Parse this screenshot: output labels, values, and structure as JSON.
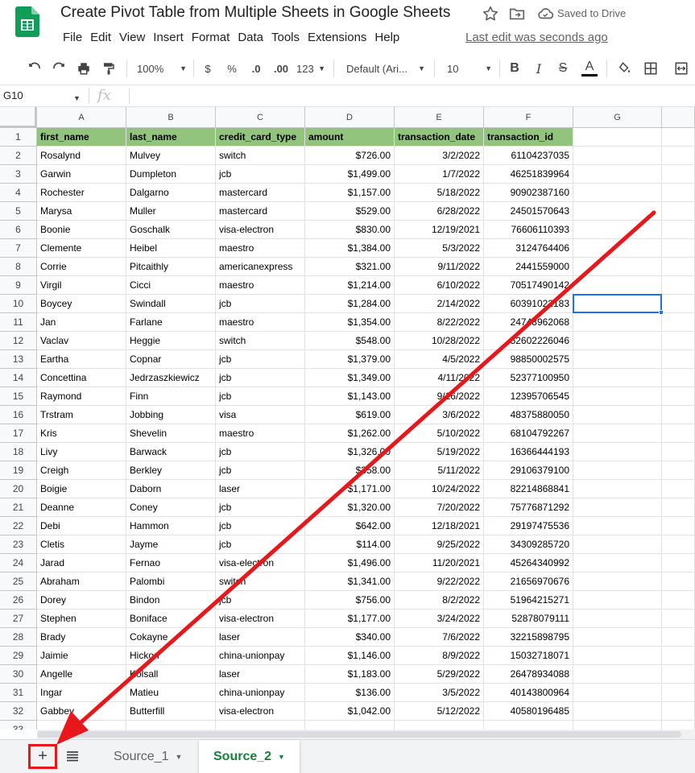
{
  "doc": {
    "title": "Create Pivot Table from Multiple Sheets in Google Sheets",
    "saved_status": "Saved to Drive",
    "last_edit": "Last edit was seconds ago"
  },
  "menu": [
    "File",
    "Edit",
    "View",
    "Insert",
    "Format",
    "Data",
    "Tools",
    "Extensions",
    "Help"
  ],
  "toolbar": {
    "zoom": "100%",
    "currency": "$",
    "percent": "%",
    "decrease_decimal": ".0",
    "increase_decimal": ".00",
    "more_formats": "123",
    "font": "Default (Ari...",
    "font_size": "10",
    "bold": "B",
    "italic": "I",
    "strike": "S",
    "text_color": "A"
  },
  "formula_bar": {
    "name_box": "G10",
    "fx": "fx",
    "value": ""
  },
  "columns": [
    "A",
    "B",
    "C",
    "D",
    "E",
    "F",
    "G"
  ],
  "header_row": [
    "first_name",
    "last_name",
    "credit_card_type",
    "amount",
    "transaction_date",
    "transaction_id"
  ],
  "rows": [
    [
      "Rosalynd",
      "Mulvey",
      "switch",
      "$726.00",
      "3/2/2022",
      "61104237035"
    ],
    [
      "Garwin",
      "Dumpleton",
      "jcb",
      "$1,499.00",
      "1/7/2022",
      "46251839964"
    ],
    [
      "Rochester",
      "Dalgarno",
      "mastercard",
      "$1,157.00",
      "5/18/2022",
      "90902387160"
    ],
    [
      "Marysa",
      "Muller",
      "mastercard",
      "$529.00",
      "6/28/2022",
      "24501570643"
    ],
    [
      "Boonie",
      "Goschalk",
      "visa-electron",
      "$830.00",
      "12/19/2021",
      "76606110393"
    ],
    [
      "Clemente",
      "Heibel",
      "maestro",
      "$1,384.00",
      "5/3/2022",
      "3124764406"
    ],
    [
      "Corrie",
      "Pitcaithly",
      "americanexpress",
      "$321.00",
      "9/11/2022",
      "2441559000"
    ],
    [
      "Virgil",
      "Cicci",
      "maestro",
      "$1,214.00",
      "6/10/2022",
      "70517490142"
    ],
    [
      "Boycey",
      "Swindall",
      "jcb",
      "$1,284.00",
      "2/14/2022",
      "60391022183"
    ],
    [
      "Jan",
      "Farlane",
      "maestro",
      "$1,354.00",
      "8/22/2022",
      "24748962068"
    ],
    [
      "Vaclav",
      "Heggie",
      "switch",
      "$548.00",
      "10/28/2022",
      "52602226046"
    ],
    [
      "Eartha",
      "Copnar",
      "jcb",
      "$1,379.00",
      "4/5/2022",
      "98850002575"
    ],
    [
      "Concettina",
      "Jedrzaszkiewicz",
      "jcb",
      "$1,349.00",
      "4/11/2022",
      "52377100950"
    ],
    [
      "Raymond",
      "Finn",
      "jcb",
      "$1,143.00",
      "9/16/2022",
      "12395706545"
    ],
    [
      "Trstram",
      "Jobbing",
      "visa",
      "$619.00",
      "3/6/2022",
      "48375880050"
    ],
    [
      "Kris",
      "Shevelin",
      "maestro",
      "$1,262.00",
      "5/10/2022",
      "68104792267"
    ],
    [
      "Livy",
      "Barwack",
      "jcb",
      "$1,326.00",
      "5/19/2022",
      "16366444193"
    ],
    [
      "Creigh",
      "Berkley",
      "jcb",
      "$358.00",
      "5/11/2022",
      "29106379100"
    ],
    [
      "Boigie",
      "Daborn",
      "laser",
      "$1,171.00",
      "10/24/2022",
      "82214868841"
    ],
    [
      "Deanne",
      "Coney",
      "jcb",
      "$1,320.00",
      "7/20/2022",
      "75776871292"
    ],
    [
      "Debi",
      "Hammon",
      "jcb",
      "$642.00",
      "12/18/2021",
      "29197475536"
    ],
    [
      "Cletis",
      "Jayme",
      "jcb",
      "$114.00",
      "9/25/2022",
      "34309285720"
    ],
    [
      "Jarad",
      "Fernao",
      "visa-electron",
      "$1,496.00",
      "11/20/2021",
      "45264340992"
    ],
    [
      "Abraham",
      "Palombi",
      "switch",
      "$1,341.00",
      "9/22/2022",
      "21656970676"
    ],
    [
      "Dorey",
      "Bindon",
      "jcb",
      "$756.00",
      "8/2/2022",
      "51964215271"
    ],
    [
      "Stephen",
      "Boniface",
      "visa-electron",
      "$1,177.00",
      "3/24/2022",
      "52878079111"
    ],
    [
      "Brady",
      "Cokayne",
      "laser",
      "$340.00",
      "7/6/2022",
      "32215898795"
    ],
    [
      "Jaimie",
      "Hickon",
      "china-unionpay",
      "$1,146.00",
      "8/9/2022",
      "15032718071"
    ],
    [
      "Angelle",
      "Kolsall",
      "laser",
      "$1,183.00",
      "5/29/2022",
      "26478934088"
    ],
    [
      "Ingar",
      "Matieu",
      "china-unionpay",
      "$136.00",
      "3/5/2022",
      "40143800964"
    ],
    [
      "Gabbey",
      "Butterfill",
      "visa-electron",
      "$1,042.00",
      "5/12/2022",
      "40580196485"
    ]
  ],
  "sheet_tabs": {
    "add_sheet": "+",
    "tabs": [
      "Source_1",
      "Source_2"
    ],
    "active": "Source_2"
  },
  "colors": {
    "header_fill": "#93c47d",
    "active_tab": "#188038",
    "annotation": "#e8171b",
    "selection": "#1a73e8"
  }
}
